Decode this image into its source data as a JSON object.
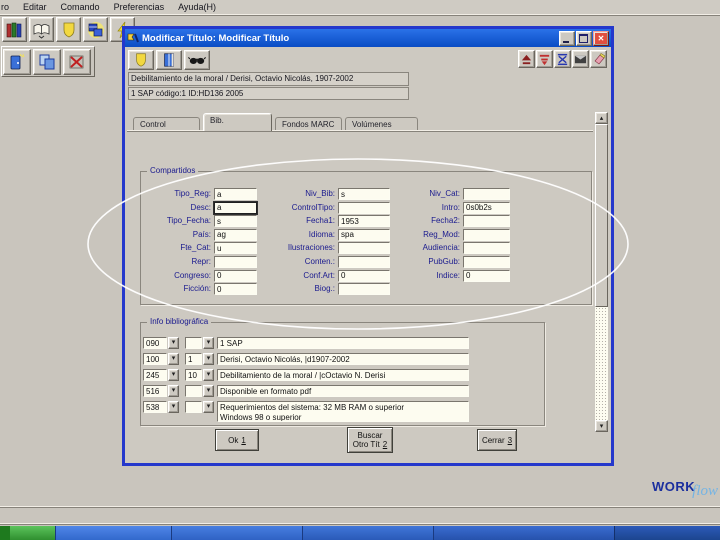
{
  "menu": {
    "items": [
      "ro",
      "Editar",
      "Comando",
      "Preferencias",
      "Ayuda(H)"
    ]
  },
  "dialog": {
    "title": "Modificar Título: Modificar Título",
    "header": {
      "title_line": "Debilitamiento de la moral / Derisi, Octavio Nicolás, 1907-2002",
      "info_line": "1 SAP   código:1   ID:HD136 2005"
    },
    "tabs": [
      {
        "label": "Control"
      },
      {
        "label": "Bib."
      },
      {
        "label": "Fondos MARC"
      },
      {
        "label": "Volúmenes"
      }
    ],
    "compartidos": {
      "legend": "Compartidos",
      "col1": [
        {
          "label": "Tipo_Reg:",
          "value": "a"
        },
        {
          "label": "Desc:",
          "value": "a"
        },
        {
          "label": "Tipo_Fecha:",
          "value": "s"
        },
        {
          "label": "País:",
          "value": "ag"
        },
        {
          "label": "Fte_Cat:",
          "value": "u"
        },
        {
          "label": "Repr:",
          "value": ""
        },
        {
          "label": "Congreso:",
          "value": "0"
        },
        {
          "label": "Ficción:",
          "value": "0"
        }
      ],
      "col2": [
        {
          "label": "Niv_Bib:",
          "value": "s"
        },
        {
          "label": "ControlTipo:",
          "value": ""
        },
        {
          "label": "Fecha1:",
          "value": "1953"
        },
        {
          "label": "Idioma:",
          "value": "spa"
        },
        {
          "label": "Ilustraciones:",
          "value": ""
        },
        {
          "label": "Conten.:",
          "value": ""
        },
        {
          "label": "Conf.Art:",
          "value": "0"
        },
        {
          "label": "Biog.:",
          "value": ""
        }
      ],
      "col3": [
        {
          "label": "Niv_Cat:",
          "value": ""
        },
        {
          "label": "Intro:",
          "value": "0s0b2s"
        },
        {
          "label": "Fecha2:",
          "value": ""
        },
        {
          "label": "Reg_Mod:",
          "value": ""
        },
        {
          "label": "Audiencia:",
          "value": ""
        },
        {
          "label": "PubGub:",
          "value": ""
        },
        {
          "label": "Indice:",
          "value": "0"
        }
      ]
    },
    "info_biblio": {
      "legend": "Info bibliográfica",
      "rows": [
        {
          "tag": "090",
          "ind": "",
          "value": "1 SAP"
        },
        {
          "tag": "100",
          "ind": "1",
          "value": "Derisi, Octavio Nicolás, |d1907-2002"
        },
        {
          "tag": "245",
          "ind": "10",
          "value": "Debilitamiento de la moral / |cOctavio N. Derisi"
        },
        {
          "tag": "516",
          "ind": "",
          "value": "Disponible en formato pdf"
        },
        {
          "tag": "538",
          "ind": "",
          "value": "Requerimientos del sistema: 32 MB RAM o superior\nWindows 98 o superior"
        }
      ]
    },
    "buttons": {
      "ok": {
        "label": "Ok",
        "accel": "1"
      },
      "buscar": {
        "line1": "Buscar",
        "line2": "Otro Tít",
        "accel": "2"
      },
      "cerrar": {
        "label": "Cerrar",
        "accel": "3"
      }
    }
  },
  "logo": {
    "bold": "WORK",
    "script": "flow"
  },
  "icons": {
    "dropdown": "▾",
    "scroll_up": "▴",
    "scroll_down": "▾",
    "close": "✕"
  },
  "colors": {
    "titlebar_blue": "#0e52cc",
    "dialog_border": "#2438cc",
    "window_gray": "#c9c5bd",
    "field_label_navy": "#1a1a8e",
    "close_button_red": "#e04f3f",
    "logo_navy": "#1b2f9e",
    "logo_lightblue": "#74b4e4",
    "taskbar_green": "#46b246",
    "taskbar_blue": "#2f66c8",
    "annotation_white": "#ffffff"
  }
}
